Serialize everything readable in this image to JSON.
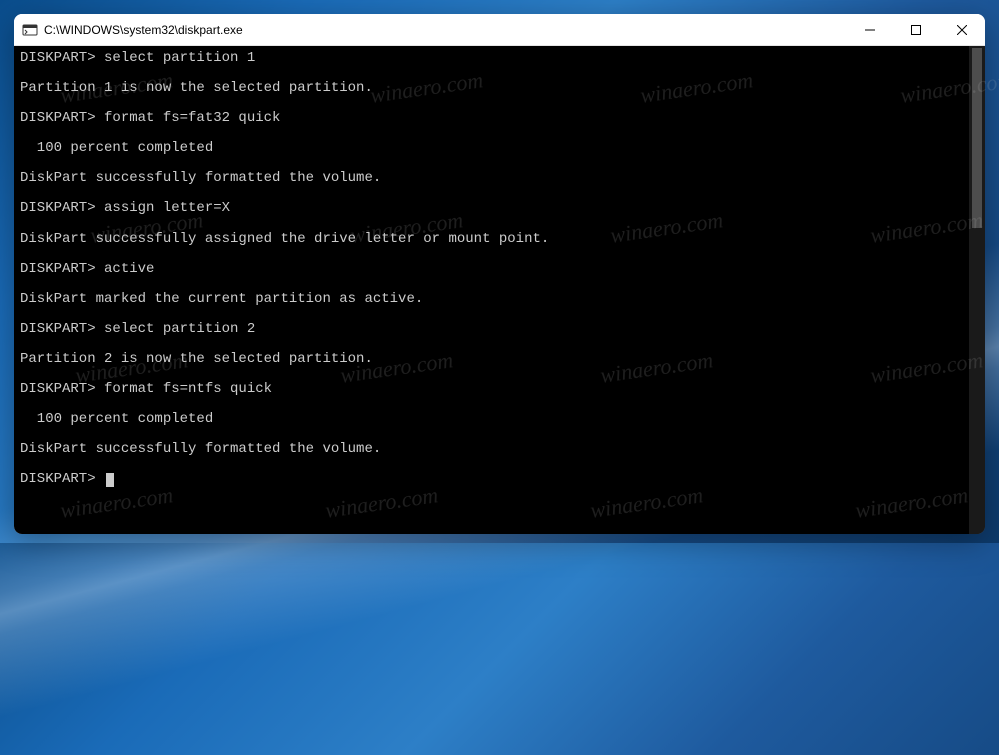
{
  "window": {
    "title": "C:\\WINDOWS\\system32\\diskpart.exe"
  },
  "console": {
    "prompt": "DISKPART>",
    "lines": [
      {
        "kind": "cmd",
        "prompt": "DISKPART>",
        "text": "select partition 1"
      },
      {
        "kind": "msg",
        "text": "Partition 1 is now the selected partition."
      },
      {
        "kind": "cmd",
        "prompt": "DISKPART>",
        "text": "format fs=fat32 quick"
      },
      {
        "kind": "ind",
        "text": "100 percent completed"
      },
      {
        "kind": "msg",
        "text": "DiskPart successfully formatted the volume."
      },
      {
        "kind": "cmd",
        "prompt": "DISKPART>",
        "text": "assign letter=X"
      },
      {
        "kind": "msg",
        "text": "DiskPart successfully assigned the drive letter or mount point."
      },
      {
        "kind": "cmd",
        "prompt": "DISKPART>",
        "text": "active"
      },
      {
        "kind": "msg",
        "text": "DiskPart marked the current partition as active."
      },
      {
        "kind": "cmd",
        "prompt": "DISKPART>",
        "text": "select partition 2"
      },
      {
        "kind": "msg",
        "text": "Partition 2 is now the selected partition."
      },
      {
        "kind": "cmd",
        "prompt": "DISKPART>",
        "text": "format fs=ntfs quick"
      },
      {
        "kind": "ind",
        "text": "100 percent completed"
      },
      {
        "kind": "msg",
        "text": "DiskPart successfully formatted the volume."
      },
      {
        "kind": "cmdlast",
        "prompt": "DISKPART>",
        "text": ""
      }
    ]
  },
  "watermark": {
    "text": "winaero.com"
  }
}
